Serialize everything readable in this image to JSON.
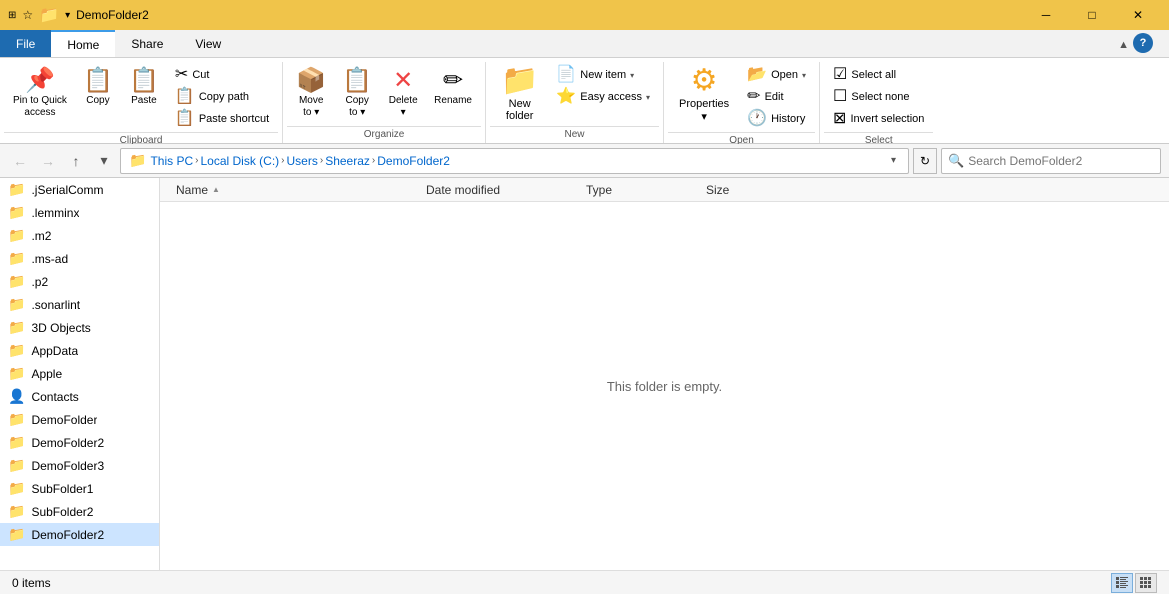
{
  "titleBar": {
    "title": "DemoFolder2",
    "minBtn": "─",
    "maxBtn": "□",
    "closeBtn": "✕"
  },
  "ribbonTabs": {
    "file": "File",
    "home": "Home",
    "share": "Share",
    "view": "View"
  },
  "ribbon": {
    "clipboard": {
      "label": "Clipboard",
      "pinToQuickAccess": "Pin to Quick\naccess",
      "copy": "Copy",
      "paste": "Paste",
      "cut": "Cut",
      "copyPath": "Copy path",
      "pasteShortcut": "Paste shortcut"
    },
    "organize": {
      "label": "Organize",
      "moveTo": "Move\nto",
      "copyTo": "Copy\nto",
      "delete": "Delete",
      "rename": "Rename"
    },
    "new": {
      "label": "New",
      "newItem": "New item",
      "easyAccess": "Easy access",
      "newFolder": "New\nfolder"
    },
    "open": {
      "label": "Open",
      "open": "Open",
      "edit": "Edit",
      "history": "History",
      "properties": "Properties"
    },
    "select": {
      "label": "Select",
      "selectAll": "Select all",
      "selectNone": "Select none",
      "invertSelection": "Invert selection"
    }
  },
  "navBar": {
    "back": "←",
    "forward": "→",
    "up": "↑",
    "recentLocations": "▾",
    "refresh": "↻",
    "breadcrumbs": [
      "This PC",
      "Local Disk (C:)",
      "Users",
      "Sheeraz",
      "DemoFolder2"
    ],
    "searchPlaceholder": "Search DemoFolder2"
  },
  "sidebar": {
    "items": [
      {
        "label": ".jSerialComm",
        "icon": "📁",
        "active": false
      },
      {
        "label": ".lemminx",
        "icon": "📁",
        "active": false
      },
      {
        "label": ".m2",
        "icon": "📁",
        "active": false
      },
      {
        "label": ".ms-ad",
        "icon": "📁",
        "active": false
      },
      {
        "label": ".p2",
        "icon": "📁",
        "active": false
      },
      {
        "label": ".sonarlint",
        "icon": "📁",
        "active": false
      },
      {
        "label": "3D Objects",
        "icon": "📁",
        "active": false,
        "iconColor": "#5bb0e0"
      },
      {
        "label": "AppData",
        "icon": "📁",
        "active": false
      },
      {
        "label": "Apple",
        "icon": "📁",
        "active": false
      },
      {
        "label": "Contacts",
        "icon": "📁",
        "active": false,
        "iconColor": "#6c7a8a"
      },
      {
        "label": "DemoFolder",
        "icon": "📁",
        "active": false
      },
      {
        "label": "DemoFolder2",
        "icon": "📁",
        "active": false
      },
      {
        "label": "DemoFolder3",
        "icon": "📁",
        "active": false
      },
      {
        "label": "SubFolder1",
        "icon": "📁",
        "active": false
      },
      {
        "label": "SubFolder2",
        "icon": "📁",
        "active": false
      },
      {
        "label": "DemoFolder2",
        "icon": "📁",
        "active": true
      }
    ]
  },
  "content": {
    "columns": {
      "name": "Name",
      "dateModified": "Date modified",
      "type": "Type",
      "size": "Size"
    },
    "emptyMessage": "This folder is empty.",
    "sortArrow": "▲"
  },
  "statusBar": {
    "itemCount": "0 items",
    "viewDetails": "▦",
    "viewList": "▤"
  }
}
